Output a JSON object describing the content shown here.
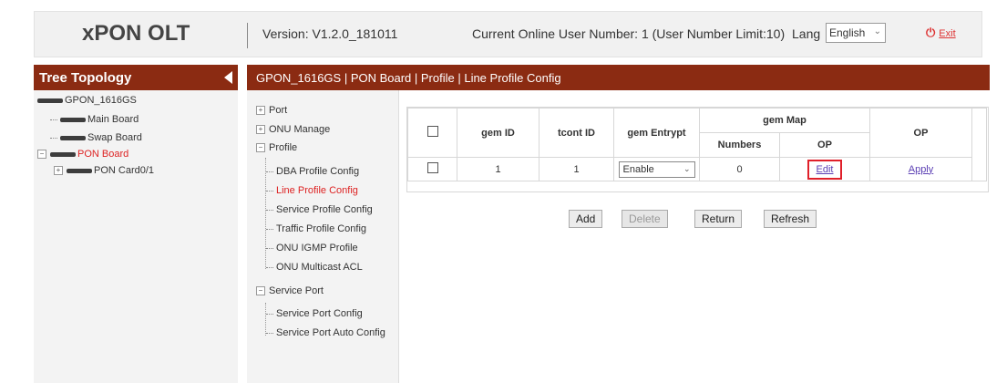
{
  "header": {
    "logo": "xPON OLT",
    "version": "Version: V1.2.0_181011",
    "online": "Current Online User Number: 1 (User Number Limit:10)",
    "lang_label": "Lang",
    "lang_value": "English",
    "exit_label": "Exit"
  },
  "left": {
    "title": "Tree Topology",
    "tree": [
      {
        "label": "GPON_1616GS"
      },
      {
        "label": "Main Board"
      },
      {
        "label": "Swap Board"
      },
      {
        "label": "PON Board"
      },
      {
        "label": "PON Card0/1"
      }
    ]
  },
  "breadcrumb": "GPON_1616GS | PON Board | Profile | Line Profile Config",
  "nav": {
    "port": "Port",
    "onu_manage": "ONU Manage",
    "profile": "Profile",
    "dba": "DBA Profile Config",
    "line": "Line Profile Config",
    "service": "Service Profile Config",
    "traffic": "Traffic Profile Config",
    "igmp": "ONU IGMP Profile",
    "multicast": "ONU Multicast ACL",
    "service_port": "Service Port",
    "sp_config": "Service Port Config",
    "sp_auto": "Service Port Auto Config"
  },
  "table": {
    "headers": {
      "gem_id": "gem ID",
      "tcont_id": "tcont ID",
      "gem_entrypt": "gem Entrypt",
      "gem_map": "gem Map",
      "numbers": "Numbers",
      "op_inner": "OP",
      "op": "OP"
    },
    "rows": [
      {
        "gem_id": "1",
        "tcont_id": "1",
        "entrypt": "Enable",
        "numbers": "0",
        "edit": "Edit",
        "apply": "Apply"
      }
    ]
  },
  "buttons": {
    "add": "Add",
    "delete": "Delete",
    "return": "Return",
    "refresh": "Refresh"
  },
  "colors": {
    "title_bar": "#8b2b12",
    "highlight": "#e0202a",
    "active_nav": "#d22222"
  }
}
